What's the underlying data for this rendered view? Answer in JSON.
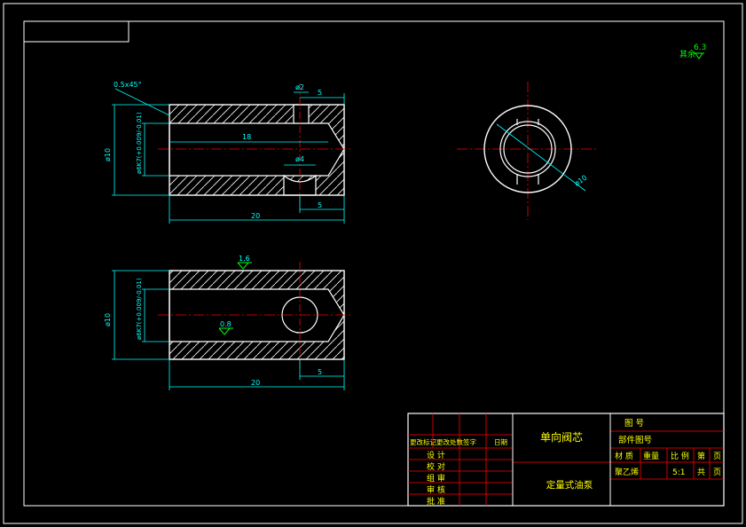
{
  "colors": {
    "background": "#000000",
    "frame": "#ffffff",
    "part": "#ffffff",
    "dimension": "#00ffff",
    "centerline": "#ff0000",
    "surface_symbol": "#00ff00",
    "title_block_line": "#ff0000",
    "title_text": "#ffff00"
  },
  "roughness_note": {
    "prefix": "其余",
    "value": "6.3"
  },
  "front_view": {
    "chamfer": "0.5x45°",
    "slot_width": "ø2",
    "slot_offset": "5",
    "bore_depth": "18",
    "hole_dia": "ø4",
    "outer_dia": "ø10",
    "bore_dia": "ø6K7(+0.009/-0.01)",
    "bottom_offset": "5",
    "total_length": "20"
  },
  "side_view": {
    "dia": "ø10"
  },
  "section_view": {
    "roughness_top": "1.6",
    "roughness_bore": "0.8",
    "outer_dia": "ø10",
    "bore_dia": "ø6K7(+0.009/-0.01)",
    "offset": "5",
    "total_length": "20"
  },
  "title_block": {
    "part_name": "单向阀芯",
    "company": "定量式油泵",
    "drawing_no_label": "图 号",
    "assembly_no_label": "部件图号",
    "material_label": "材 质",
    "weight_label": "重量",
    "scale_label": "比 例",
    "sheet_label": "第",
    "page_unit": "页",
    "total_label": "共",
    "material": "聚乙烯",
    "scale": "5:1",
    "revision_header": "更改标记更改处数签字",
    "date_header": "日期",
    "roles": [
      "设 计",
      "校 对",
      "组 审",
      "审 核",
      "批 准"
    ]
  }
}
